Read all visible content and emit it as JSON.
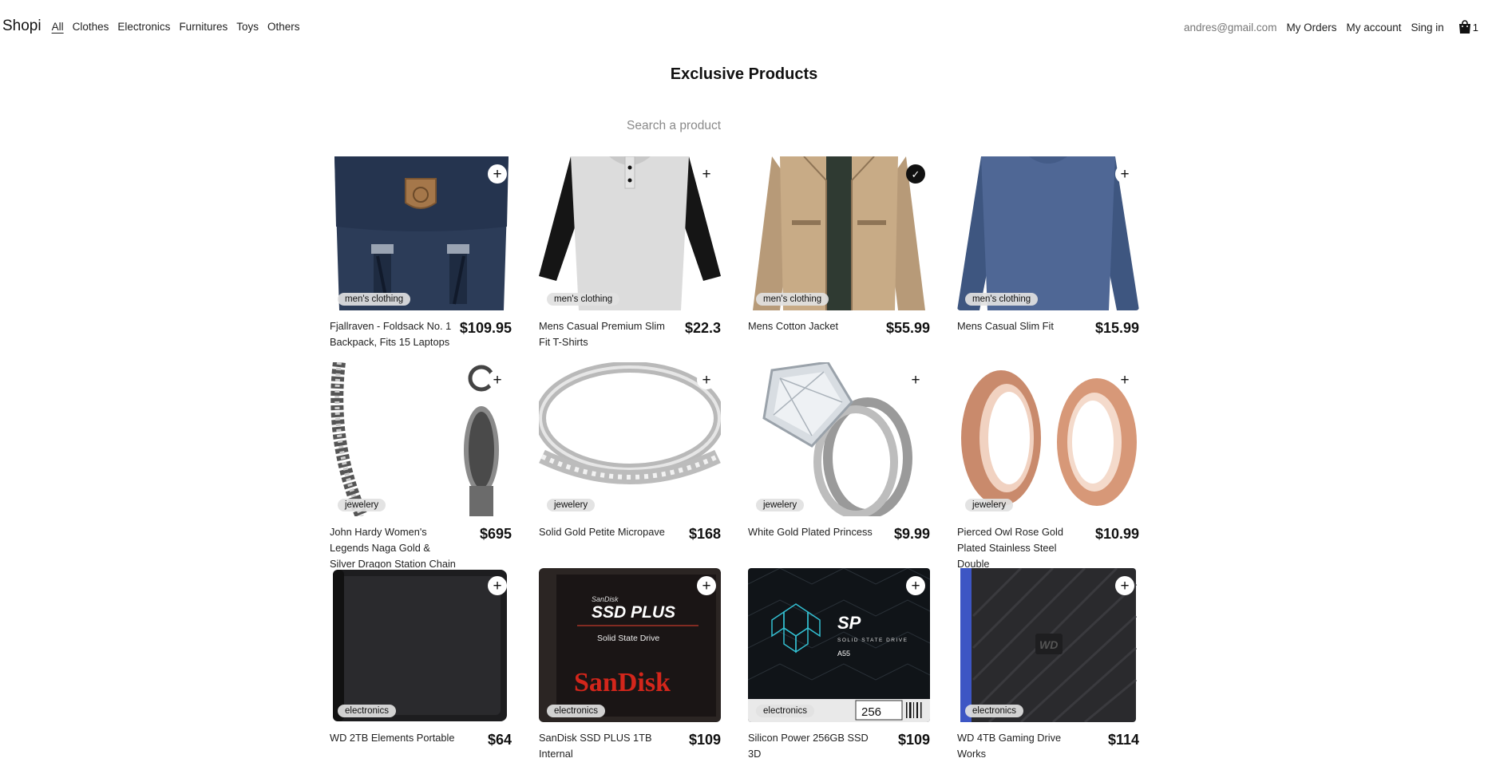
{
  "nav": {
    "brand": "Shopi",
    "links": [
      "All",
      "Clothes",
      "Electronics",
      "Furnitures",
      "Toys",
      "Others"
    ],
    "email": "andres@gmail.com",
    "my_orders": "My Orders",
    "my_account": "My account",
    "sign_in": "Sing in",
    "cart_count": "1"
  },
  "page": {
    "title": "Exclusive Products",
    "search_placeholder": "Search a product"
  },
  "products": [
    {
      "name": "Fjallraven - Foldsack No. 1 Backpack, Fits 15 Laptops",
      "price": "$109.95",
      "category": "men's clothing",
      "action": "+",
      "image": "backpack-icon"
    },
    {
      "name": "Mens Casual Premium Slim Fit T-Shirts",
      "price": "$22.3",
      "category": "men's clothing",
      "action": "+",
      "image": "tshirt-icon"
    },
    {
      "name": "Mens Cotton Jacket",
      "price": "$55.99",
      "category": "men's clothing",
      "action": "✓",
      "image": "jacket-icon"
    },
    {
      "name": "Mens Casual Slim Fit",
      "price": "$15.99",
      "category": "men's clothing",
      "action": "+",
      "image": "longsleeve-icon"
    },
    {
      "name": "John Hardy Women's Legends Naga Gold & Silver Dragon Station Chain Bracelet",
      "price": "$695",
      "category": "jewelery",
      "action": "+",
      "image": "bracelet-icon"
    },
    {
      "name": "Solid Gold Petite Micropave",
      "price": "$168",
      "category": "jewelery",
      "action": "+",
      "image": "ring-band-icon"
    },
    {
      "name": "White Gold Plated Princess",
      "price": "$9.99",
      "category": "jewelery",
      "action": "+",
      "image": "diamond-ring-icon"
    },
    {
      "name": "Pierced Owl Rose Gold Plated Stainless Steel Double",
      "price": "$10.99",
      "category": "jewelery",
      "action": "+",
      "image": "tunnel-plugs-icon"
    },
    {
      "name": "WD 2TB Elements Portable",
      "price": "$64",
      "category": "electronics",
      "action": "+",
      "image": "hard-drive-icon"
    },
    {
      "name": "SanDisk SSD PLUS 1TB Internal",
      "price": "$109",
      "category": "electronics",
      "action": "+",
      "image": "ssd-icon"
    },
    {
      "name": "Silicon Power 256GB SSD 3D",
      "price": "$109",
      "category": "electronics",
      "action": "+",
      "image": "ssd-sp-icon"
    },
    {
      "name": "WD 4TB Gaming Drive Works",
      "price": "$114",
      "category": "electronics",
      "action": "+",
      "image": "gaming-drive-icon"
    }
  ],
  "sandisk": {
    "brand_small": "SanDisk",
    "line": "SSD PLUS",
    "sub": "Solid State Drive",
    "logo": "SanDisk"
  },
  "sp": {
    "logo": "SP",
    "sub": "SOLID STATE DRIVE",
    "model": "A55",
    "capacity": "256"
  },
  "wd": {
    "logo": "WD"
  }
}
